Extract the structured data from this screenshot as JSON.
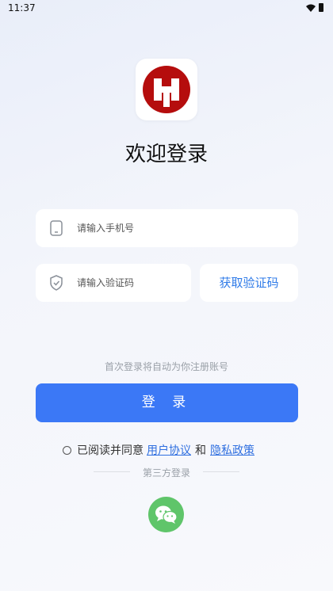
{
  "status_bar": {
    "time": "11:37"
  },
  "app": {
    "title": "欢迎登录",
    "logo_icon": "app-logo-icon"
  },
  "form": {
    "phone_placeholder": "请输入手机号",
    "code_placeholder": "请输入验证码",
    "get_code_label": "获取验证码",
    "hint": "首次登录将自动为你注册账号",
    "login_label": "登 录"
  },
  "agreement": {
    "prefix": "已阅读并同意",
    "user_agreement": "用户协议",
    "and": "和",
    "privacy_policy": "隐私政策"
  },
  "third_party": {
    "label": "第三方登录",
    "icon": "wechat-icon"
  },
  "colors": {
    "primary": "#3b78f6",
    "link": "#2f6fe0",
    "wechat": "#5fc56a",
    "logo": "#b50d0d"
  }
}
